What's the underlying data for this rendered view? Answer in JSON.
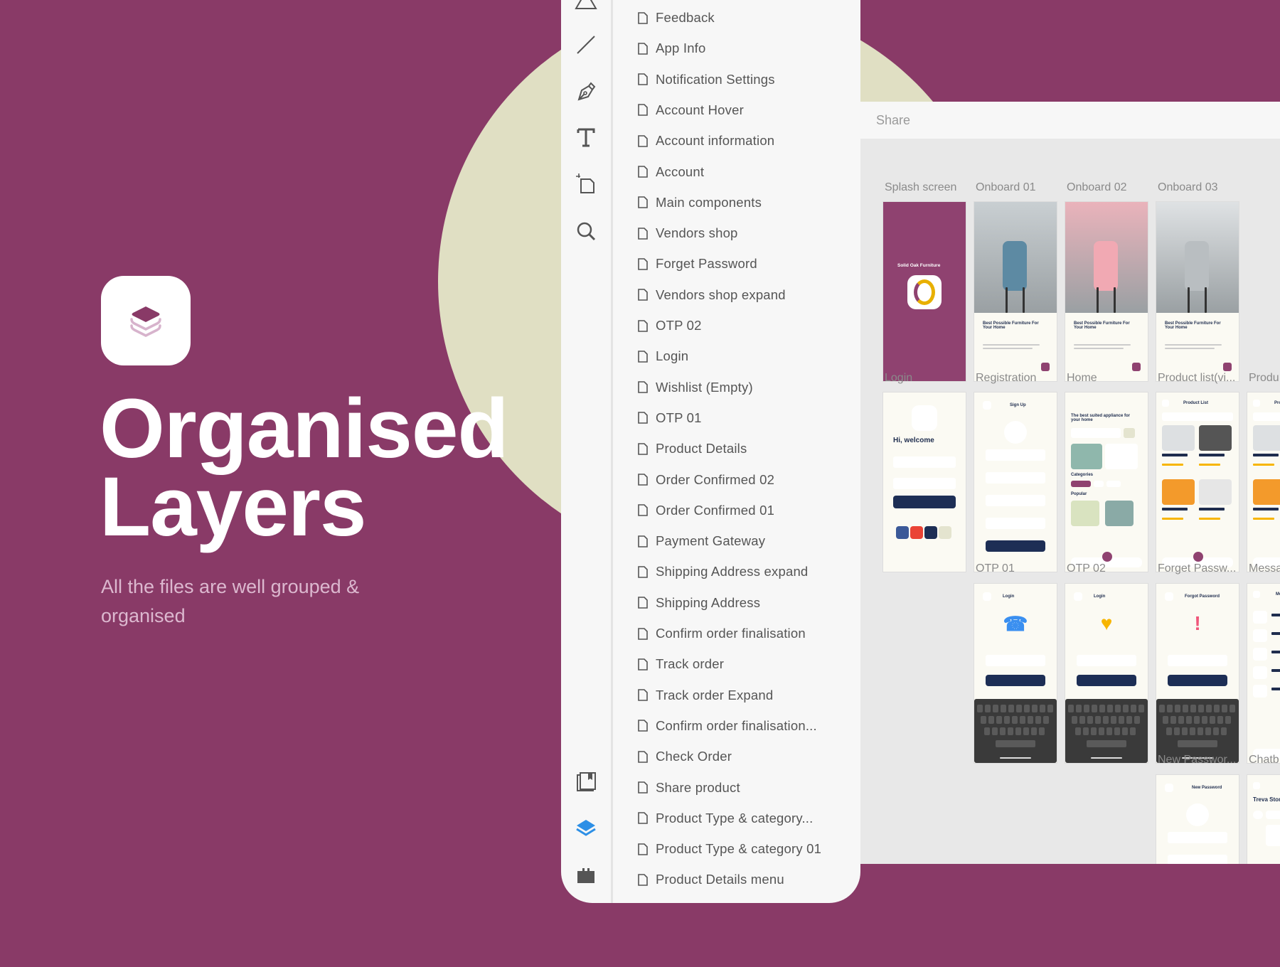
{
  "colors": {
    "background": "#893a67",
    "accent_circle": "#e0dfc3",
    "active_tool": "#2d8fe6",
    "button_navy": "#1d2e55",
    "panel": "#f7f7f7"
  },
  "hero": {
    "logo_icon": "layers-icon",
    "title_line1": "Organised",
    "title_line2": "Layers",
    "subtitle": "All the files are well grouped & organised"
  },
  "toolbar": {
    "tools": [
      {
        "icon": "triangle-icon"
      },
      {
        "icon": "line-icon"
      },
      {
        "icon": "pen-icon"
      },
      {
        "icon": "text-icon"
      },
      {
        "icon": "artboard-icon"
      },
      {
        "icon": "zoom-icon"
      },
      {
        "icon": "assets-icon"
      },
      {
        "icon": "layers-icon",
        "active": true
      },
      {
        "icon": "plugins-icon"
      }
    ]
  },
  "layers": [
    "Feedback",
    "App Info",
    "Notification Settings",
    "Account Hover",
    "Account information",
    "Account",
    "Main components",
    "Vendors shop",
    "Forget Password",
    "Vendors shop expand",
    "OTP 02",
    "Login",
    "Wishlist (Empty)",
    "OTP 01",
    "Product Details",
    "Order Confirmed 02",
    "Order Confirmed 01",
    "Payment Gateway",
    "Shipping Address expand",
    "Shipping Address",
    "Confirm order finalisation",
    "Track order",
    "Track order Expand",
    "Confirm order finalisation...",
    "Check Order",
    "Share product",
    "Product Type & category...",
    "Product Type & category 01",
    "Product Details menu"
  ],
  "canvas": {
    "header": "Share",
    "labels": [
      {
        "text": "Splash screen",
        "row": 0,
        "col": 0
      },
      {
        "text": "Onboard 01",
        "row": 0,
        "col": 1
      },
      {
        "text": "Onboard 02",
        "row": 0,
        "col": 2
      },
      {
        "text": "Onboard 03",
        "row": 0,
        "col": 3
      },
      {
        "text": "Login",
        "row": 1,
        "col": 0
      },
      {
        "text": "Registration",
        "row": 1,
        "col": 1
      },
      {
        "text": "Home",
        "row": 1,
        "col": 2
      },
      {
        "text": "Product list(vi...",
        "row": 1,
        "col": 3
      },
      {
        "text": "Produ",
        "row": 1,
        "col": 4
      },
      {
        "text": "OTP 01",
        "row": 2,
        "col": 1
      },
      {
        "text": "OTP 02",
        "row": 2,
        "col": 2
      },
      {
        "text": "Forget Passw...",
        "row": 2,
        "col": 3
      },
      {
        "text": "Messa",
        "row": 2,
        "col": 4
      },
      {
        "text": "New Passwor...",
        "row": 3,
        "col": 3
      },
      {
        "text": "Chatb",
        "row": 3,
        "col": 4
      }
    ],
    "artboards": [
      {
        "row": 0,
        "col": 0,
        "type": "splash",
        "title": "Solid Oak Furniture"
      },
      {
        "row": 0,
        "col": 1,
        "type": "onboard",
        "photo": "#c9cfd2",
        "chair": "#5d8aa3",
        "title": "Best Possible Furniture For Your Home"
      },
      {
        "row": 0,
        "col": 2,
        "type": "onboard",
        "photo": "#eab3bb",
        "chair": "#f1a9b3",
        "title": "Best Possible Furniture For Your Home"
      },
      {
        "row": 0,
        "col": 3,
        "type": "onboard",
        "photo": "#dfe2e4",
        "chair": "#b9bec1",
        "title": "Best Possible Furniture For Your Home"
      },
      {
        "row": 1,
        "col": 0,
        "type": "login",
        "title": "Hi, welcome"
      },
      {
        "row": 1,
        "col": 1,
        "type": "form",
        "title": "Sign Up"
      },
      {
        "row": 1,
        "col": 2,
        "type": "home",
        "title": "The best suited appliance for your home",
        "section1": "Categories",
        "section2": "Popular"
      },
      {
        "row": 1,
        "col": 3,
        "type": "list",
        "title": "Product List"
      },
      {
        "row": 1,
        "col": 4,
        "type": "list",
        "title": "Product List"
      },
      {
        "row": 2,
        "col": 1,
        "type": "keyboard",
        "title": "Login",
        "glyph": "☎",
        "glyph_color": "#3a8ff0"
      },
      {
        "row": 2,
        "col": 2,
        "type": "keyboard",
        "title": "Login",
        "glyph": "♥",
        "glyph_color": "#f7b500"
      },
      {
        "row": 2,
        "col": 3,
        "type": "keyboard",
        "title": "Forgot Password",
        "glyph": "!",
        "glyph_color": "#f0567a"
      },
      {
        "row": 2,
        "col": 4,
        "type": "chatlist",
        "title": "Messages"
      },
      {
        "row": 3,
        "col": 3,
        "type": "form",
        "title": "New Password"
      },
      {
        "row": 3,
        "col": 4,
        "type": "chat",
        "title": "Treva Stone"
      }
    ]
  }
}
